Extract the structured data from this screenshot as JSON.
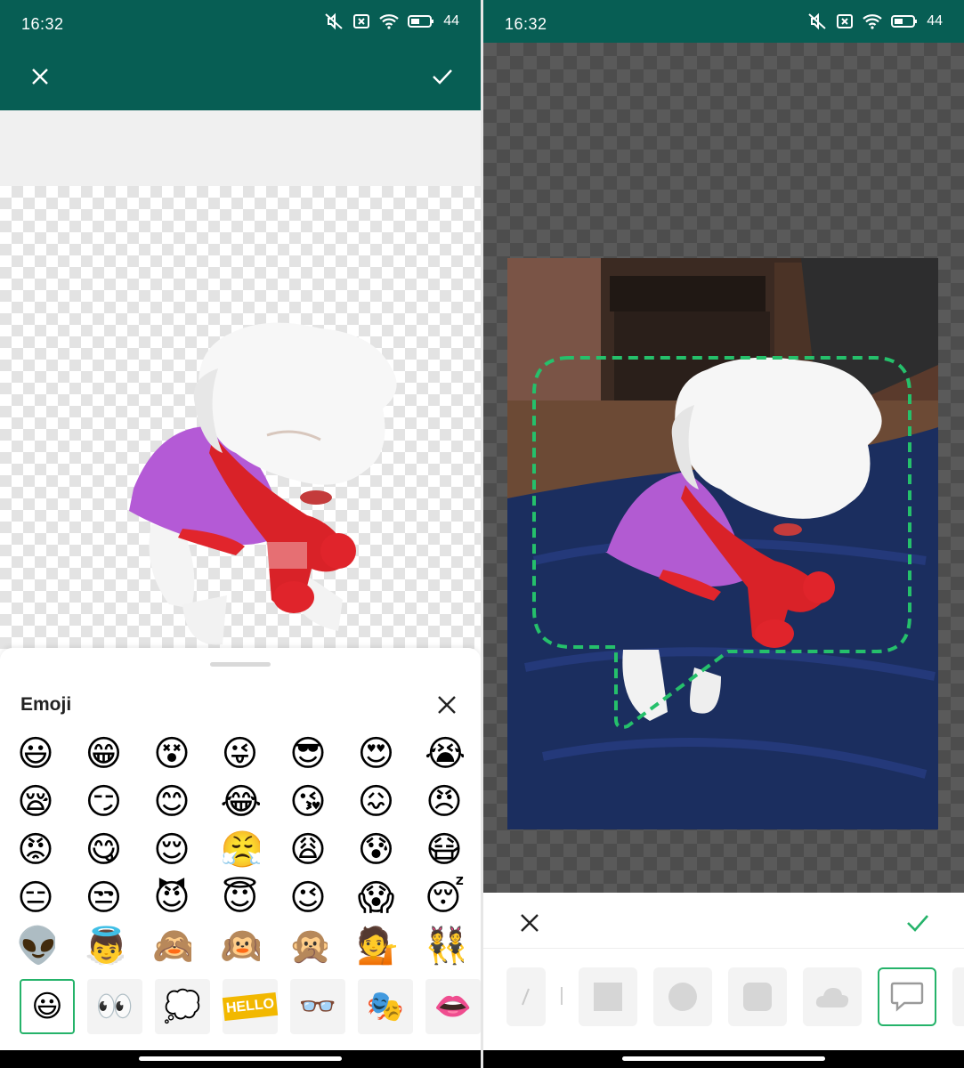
{
  "status": {
    "time": "16:32",
    "battery": "44"
  },
  "left": {
    "sheet_title": "Emoji",
    "emoji_rows": [
      [
        "😃",
        "😁",
        "😵",
        "😜",
        "😎",
        "😍",
        "😭"
      ],
      [
        "😪",
        "😏",
        "😊",
        "😂",
        "😘",
        "😖",
        "😠"
      ],
      [
        "😡",
        "😋",
        "😌",
        "😤",
        "😩",
        "😰",
        "😷"
      ],
      [
        "😑",
        "😒",
        "😈",
        "😇",
        "😉",
        "😱",
        "😴"
      ],
      [
        "👽",
        "👼",
        "🙈",
        "🙉",
        "🙊",
        "💁",
        "👯"
      ]
    ],
    "categories": [
      {
        "name": "emoji",
        "glyph": "😃",
        "selected": true
      },
      {
        "name": "cartoon-face",
        "glyph": "👀",
        "selected": false
      },
      {
        "name": "thought-bubble",
        "glyph": "💭",
        "selected": false
      },
      {
        "name": "hello-sticker",
        "glyph": "HELLO",
        "selected": false
      },
      {
        "name": "glasses",
        "glyph": "👓",
        "selected": false
      },
      {
        "name": "mask",
        "glyph": "🎭",
        "selected": false
      },
      {
        "name": "lips",
        "glyph": "👄",
        "selected": false
      }
    ]
  },
  "right": {
    "shapes": [
      {
        "name": "freehand",
        "selected": false
      },
      {
        "name": "square",
        "selected": false
      },
      {
        "name": "circle",
        "selected": false
      },
      {
        "name": "rounded-square",
        "selected": false
      },
      {
        "name": "cloud",
        "selected": false
      },
      {
        "name": "speech-bubble",
        "selected": true
      }
    ]
  },
  "colors": {
    "header": "#075e54",
    "accent": "#25b36a"
  }
}
